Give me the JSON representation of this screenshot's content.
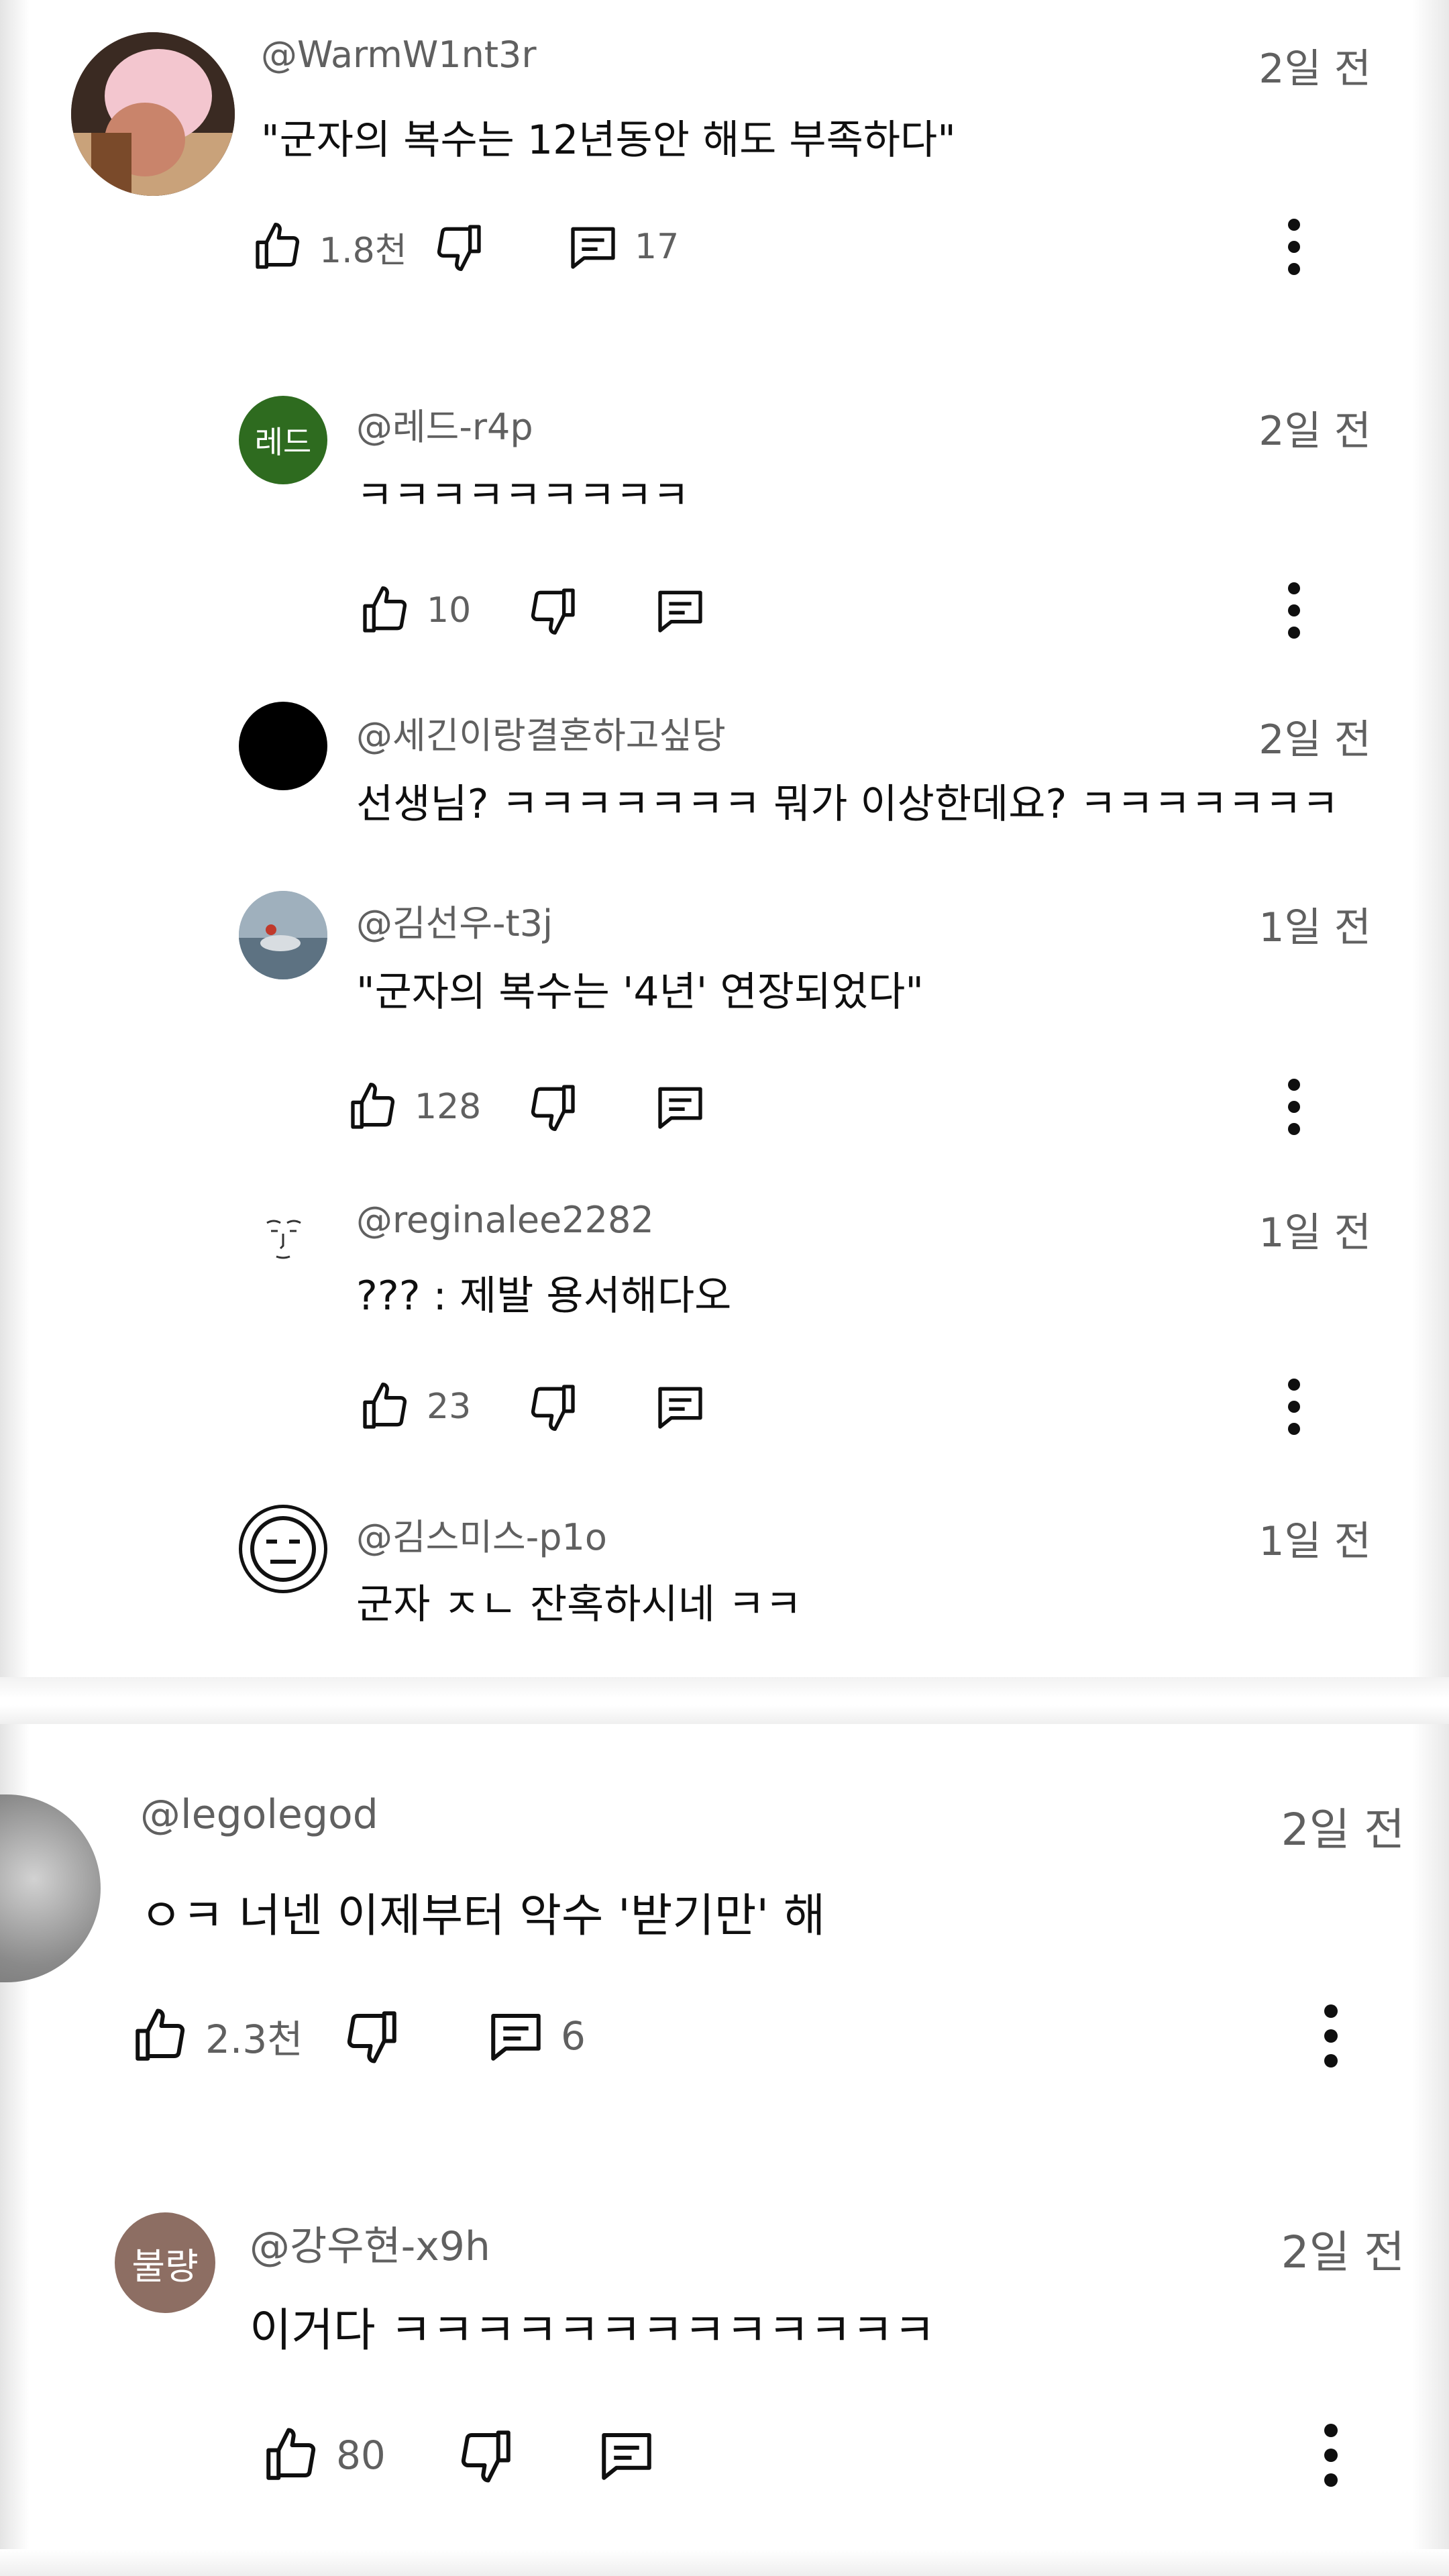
{
  "thread1": {
    "comment": {
      "author": "@WarmW1nt3r",
      "time": "2일 전",
      "text": "\"군자의 복수는 12년동안 해도 부족하다\"",
      "likes": "1.8천",
      "replies": "17"
    },
    "replies": [
      {
        "avatar_label": "레드",
        "avatar_color": "#2e6b1f",
        "author": "@레드-r4p",
        "time": "2일 전",
        "text": "ㅋㅋㅋㅋㅋㅋㅋㅋㅋ",
        "likes": "10"
      },
      {
        "avatar_color": "#000000",
        "author": "@세긴이랑결혼하고싶당",
        "time": "2일 전",
        "text": "선생님? ㅋㅋㅋㅋㅋㅋㅋ 뭐가 이상한데요? ㅋㅋㅋㅋㅋㅋㅋ",
        "likes": ""
      },
      {
        "avatar_color": "#8fa1ae",
        "author": "@김선우-t3j",
        "time": "1일 전",
        "text": "\"군자의 복수는 '4년' 연장되었다\"",
        "likes": "128"
      },
      {
        "avatar_color": "#ffffff",
        "author": "@reginalee2282",
        "time": "1일 전",
        "text": "??? : 제발 용서해다오",
        "likes": "23"
      },
      {
        "avatar_color": "#ffffff",
        "author": "@김스미스-p1o",
        "time": "1일 전",
        "text": "군자 ㅈㄴ 잔혹하시네 ㅋㅋ",
        "likes": ""
      }
    ]
  },
  "thread2": {
    "comment": {
      "author": "@legolegod",
      "time": "2일 전",
      "text": "ㅇㅋ 너넨 이제부터 악수 '받기만' 해",
      "likes": "2.3천",
      "replies": "6"
    },
    "replies": [
      {
        "avatar_label": "불량",
        "avatar_color": "#8d6e63",
        "author": "@강우현-x9h",
        "time": "2일 전",
        "text": "이거다 ㅋㅋㅋㅋㅋㅋㅋㅋㅋㅋㅋㅋㅋ",
        "likes": "80"
      }
    ]
  },
  "icons": [
    "like-icon",
    "dislike-icon",
    "reply-icon",
    "more-vert-icon"
  ],
  "colors": {
    "text": "#0f0f0f",
    "meta": "#606060",
    "background": "#ffffff"
  }
}
